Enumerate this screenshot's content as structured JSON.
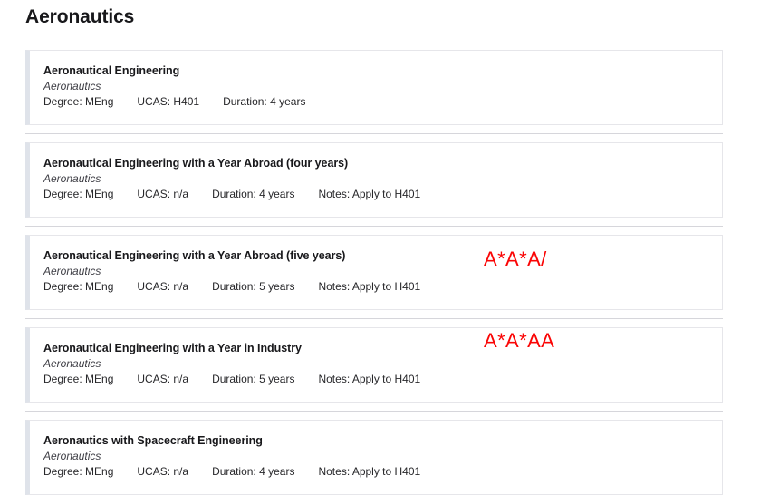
{
  "page": {
    "title": "Aeronautics"
  },
  "annotation": {
    "name": "grade-requirement-annotation",
    "color": "#fa0505",
    "line1": "A*A*A/",
    "line2": "A*A*AA"
  },
  "labels": {
    "degree_prefix": "Degree:",
    "ucas_prefix": "UCAS:",
    "duration_prefix": "Duration:",
    "notes_prefix": "Notes:"
  },
  "courses": [
    {
      "name": "Aeronautical Engineering",
      "department": "Aeronautics",
      "degree": "Degree: MEng",
      "ucas": "UCAS: H401",
      "duration": "Duration: 4 years",
      "notes": ""
    },
    {
      "name": "Aeronautical Engineering with a Year Abroad (four years)",
      "department": "Aeronautics",
      "degree": "Degree: MEng",
      "ucas": "UCAS: n/a",
      "duration": "Duration: 4 years",
      "notes": "Notes: Apply to H401"
    },
    {
      "name": "Aeronautical Engineering with a Year Abroad (five years)",
      "department": "Aeronautics",
      "degree": "Degree: MEng",
      "ucas": "UCAS: n/a",
      "duration": "Duration: 5 years",
      "notes": "Notes: Apply to H401"
    },
    {
      "name": "Aeronautical Engineering with a Year in Industry",
      "department": "Aeronautics",
      "degree": "Degree: MEng",
      "ucas": "UCAS: n/a",
      "duration": "Duration: 5 years",
      "notes": "Notes: Apply to H401"
    },
    {
      "name": "Aeronautics with Spacecraft Engineering",
      "department": "Aeronautics",
      "degree": "Degree: MEng",
      "ucas": "UCAS: n/a",
      "duration": "Duration: 4 years",
      "notes": "Notes: Apply to H401"
    }
  ]
}
